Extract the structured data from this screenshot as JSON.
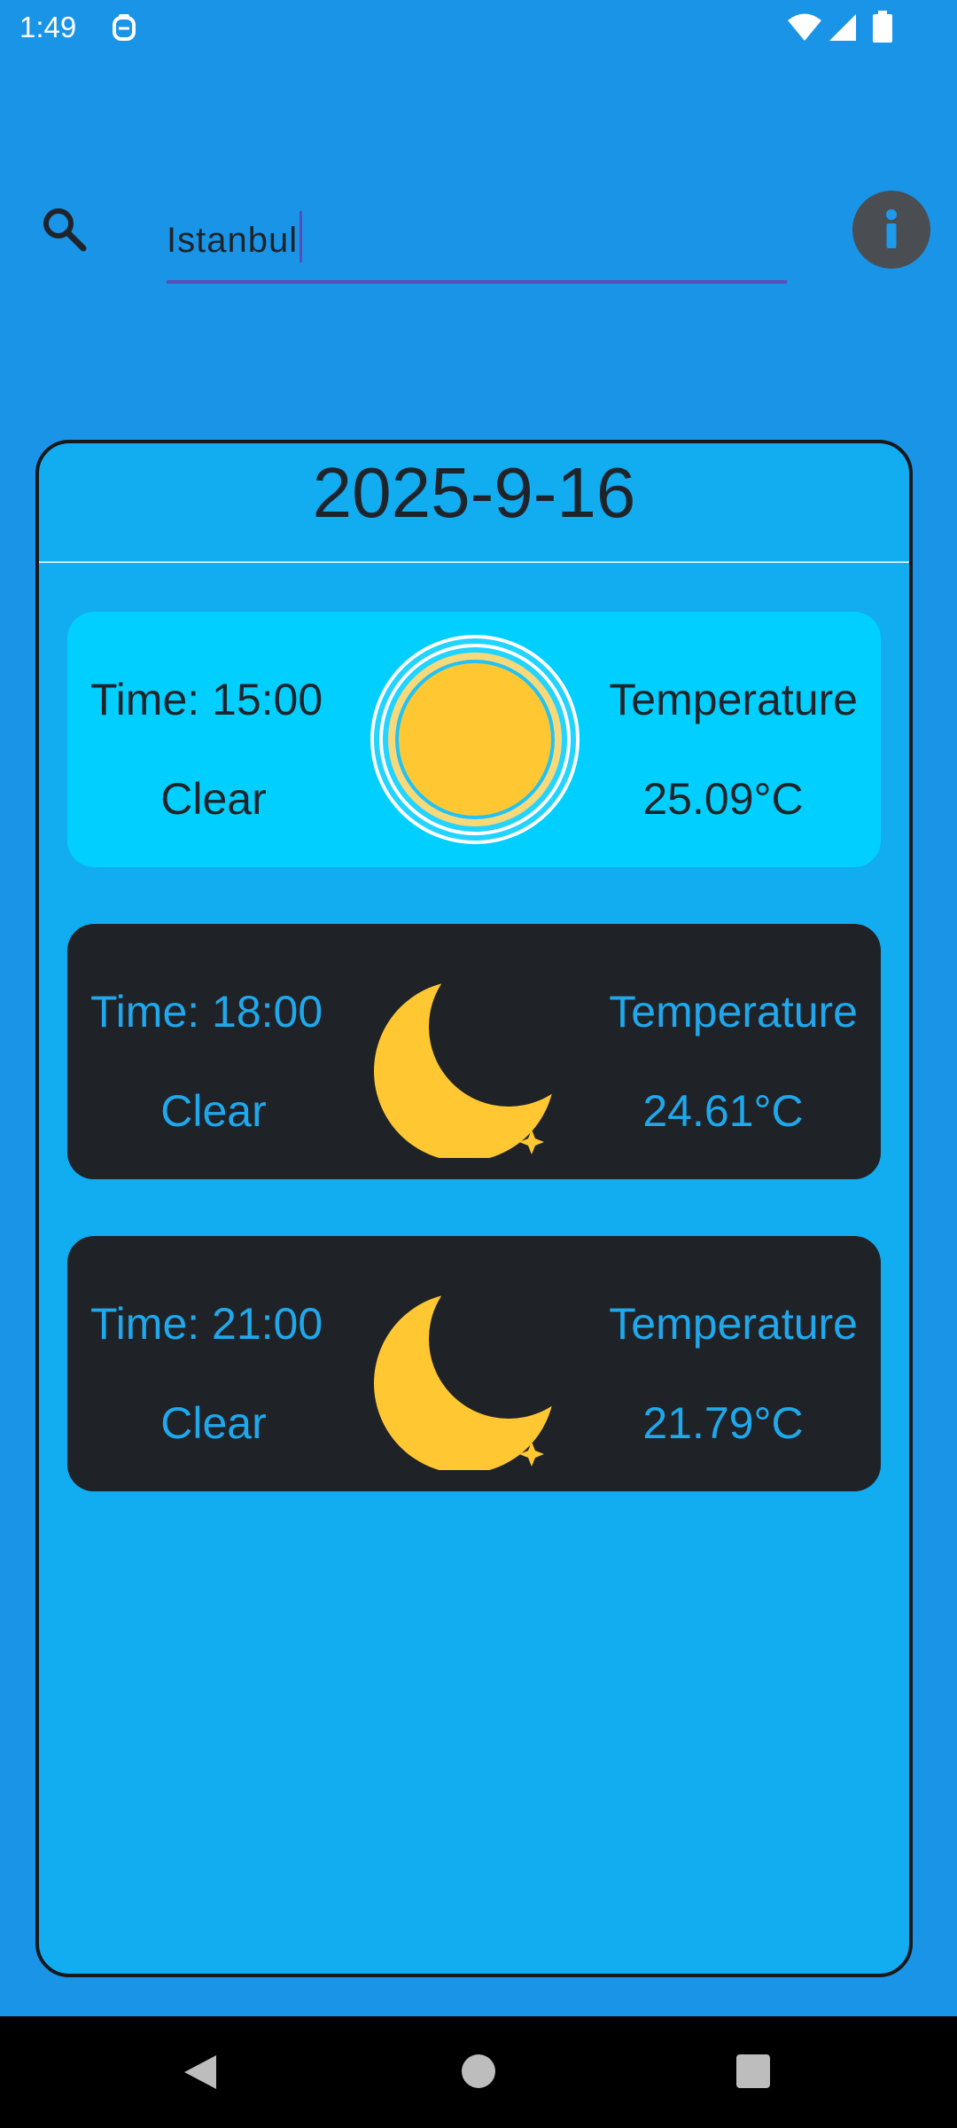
{
  "status_bar": {
    "time": "1:49",
    "icons": [
      "app-notification-icon",
      "wifi-icon",
      "signal-icon",
      "battery-icon"
    ]
  },
  "search": {
    "icon": "search-icon",
    "value": "Istanbul"
  },
  "info_button": {
    "icon": "info-icon"
  },
  "forecast": {
    "date": "2025-9-16",
    "items": [
      {
        "time": "Time: 15:00",
        "condition": "Clear",
        "temperature_label": "Temperature",
        "temperature": "25.09°C",
        "icon": "sun-icon",
        "theme": "day"
      },
      {
        "time": "Time: 18:00",
        "condition": "Clear",
        "temperature_label": "Temperature",
        "temperature": "24.61°C",
        "icon": "moon-icon",
        "theme": "night"
      },
      {
        "time": "Time: 21:00",
        "condition": "Clear",
        "temperature_label": "Temperature",
        "temperature": "21.79°C",
        "icon": "moon-icon",
        "theme": "night"
      }
    ]
  },
  "nav_bar": {
    "icons": [
      "back-icon",
      "home-icon",
      "recents-icon"
    ]
  },
  "colors": {
    "background": "#1A94E6",
    "panel": "#12ACF0",
    "day_card": "#00CFFF",
    "night_card": "#1F2226",
    "night_text": "#1FA8EC",
    "sun": "#FFC832",
    "accent_underline": "#5B4DB8"
  }
}
